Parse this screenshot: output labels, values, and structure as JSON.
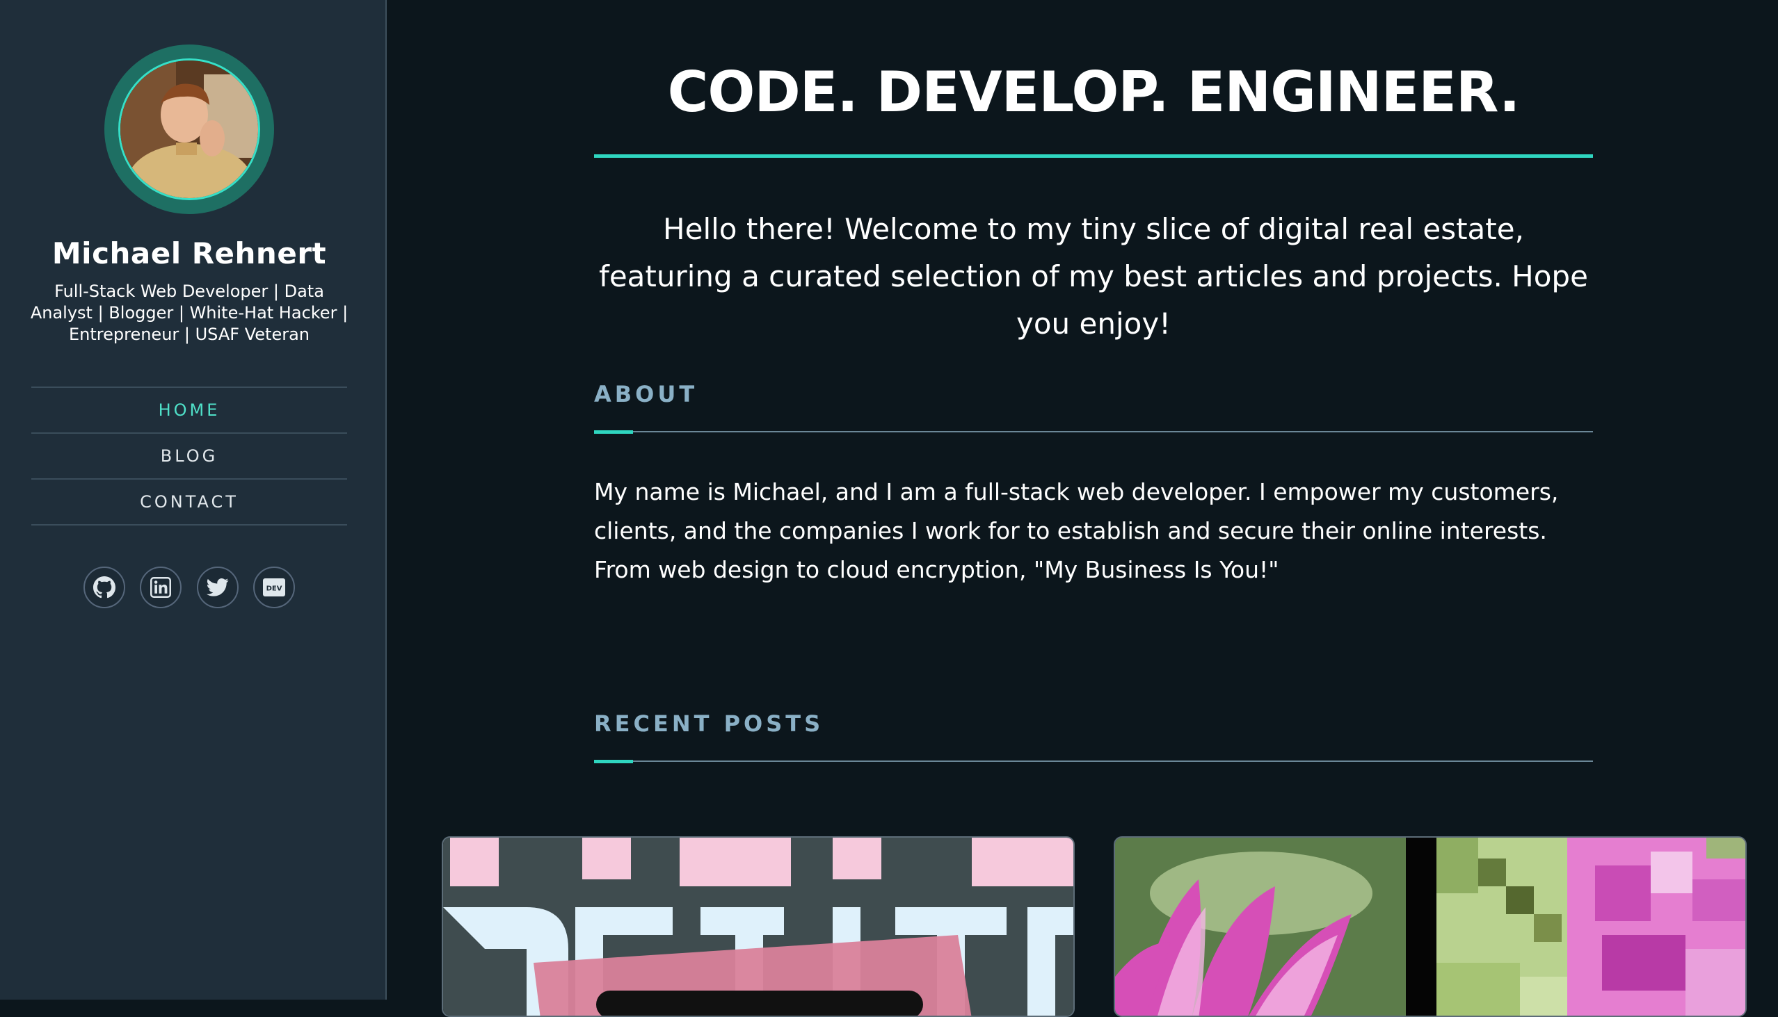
{
  "profile": {
    "name": "Michael Rehnert",
    "tagline": "Full-Stack Web Developer | Data Analyst | Blogger | White-Hat Hacker | Entrepreneur | USAF Veteran"
  },
  "nav": {
    "items": [
      {
        "label": "HOME",
        "active": true
      },
      {
        "label": "BLOG",
        "active": false
      },
      {
        "label": "CONTACT",
        "active": false
      }
    ]
  },
  "social": {
    "icons": [
      "github-icon",
      "linkedin-icon",
      "twitter-icon",
      "dev-icon"
    ],
    "dev_label": "DEV"
  },
  "hero": {
    "title": "CODE. DEVELOP. ENGINEER.",
    "intro": "Hello there! Welcome to my tiny slice of digital real estate, featuring a curated selection of my best articles and projects. Hope you enjoy!"
  },
  "about": {
    "heading": "ABOUT",
    "text": "My name is Michael, and I am a full-stack web developer. I empower my customers, clients, and the companies I work for to establish and secure their online interests. From web design to cloud encryption, \"My Business Is You!\""
  },
  "recent_posts": {
    "heading": "RECENT POSTS"
  },
  "colors": {
    "accent": "#2fd6c0",
    "sidebar_bg": "#1f2e3a",
    "page_bg": "#0c161c",
    "heading_muted": "#8ab0c6"
  }
}
